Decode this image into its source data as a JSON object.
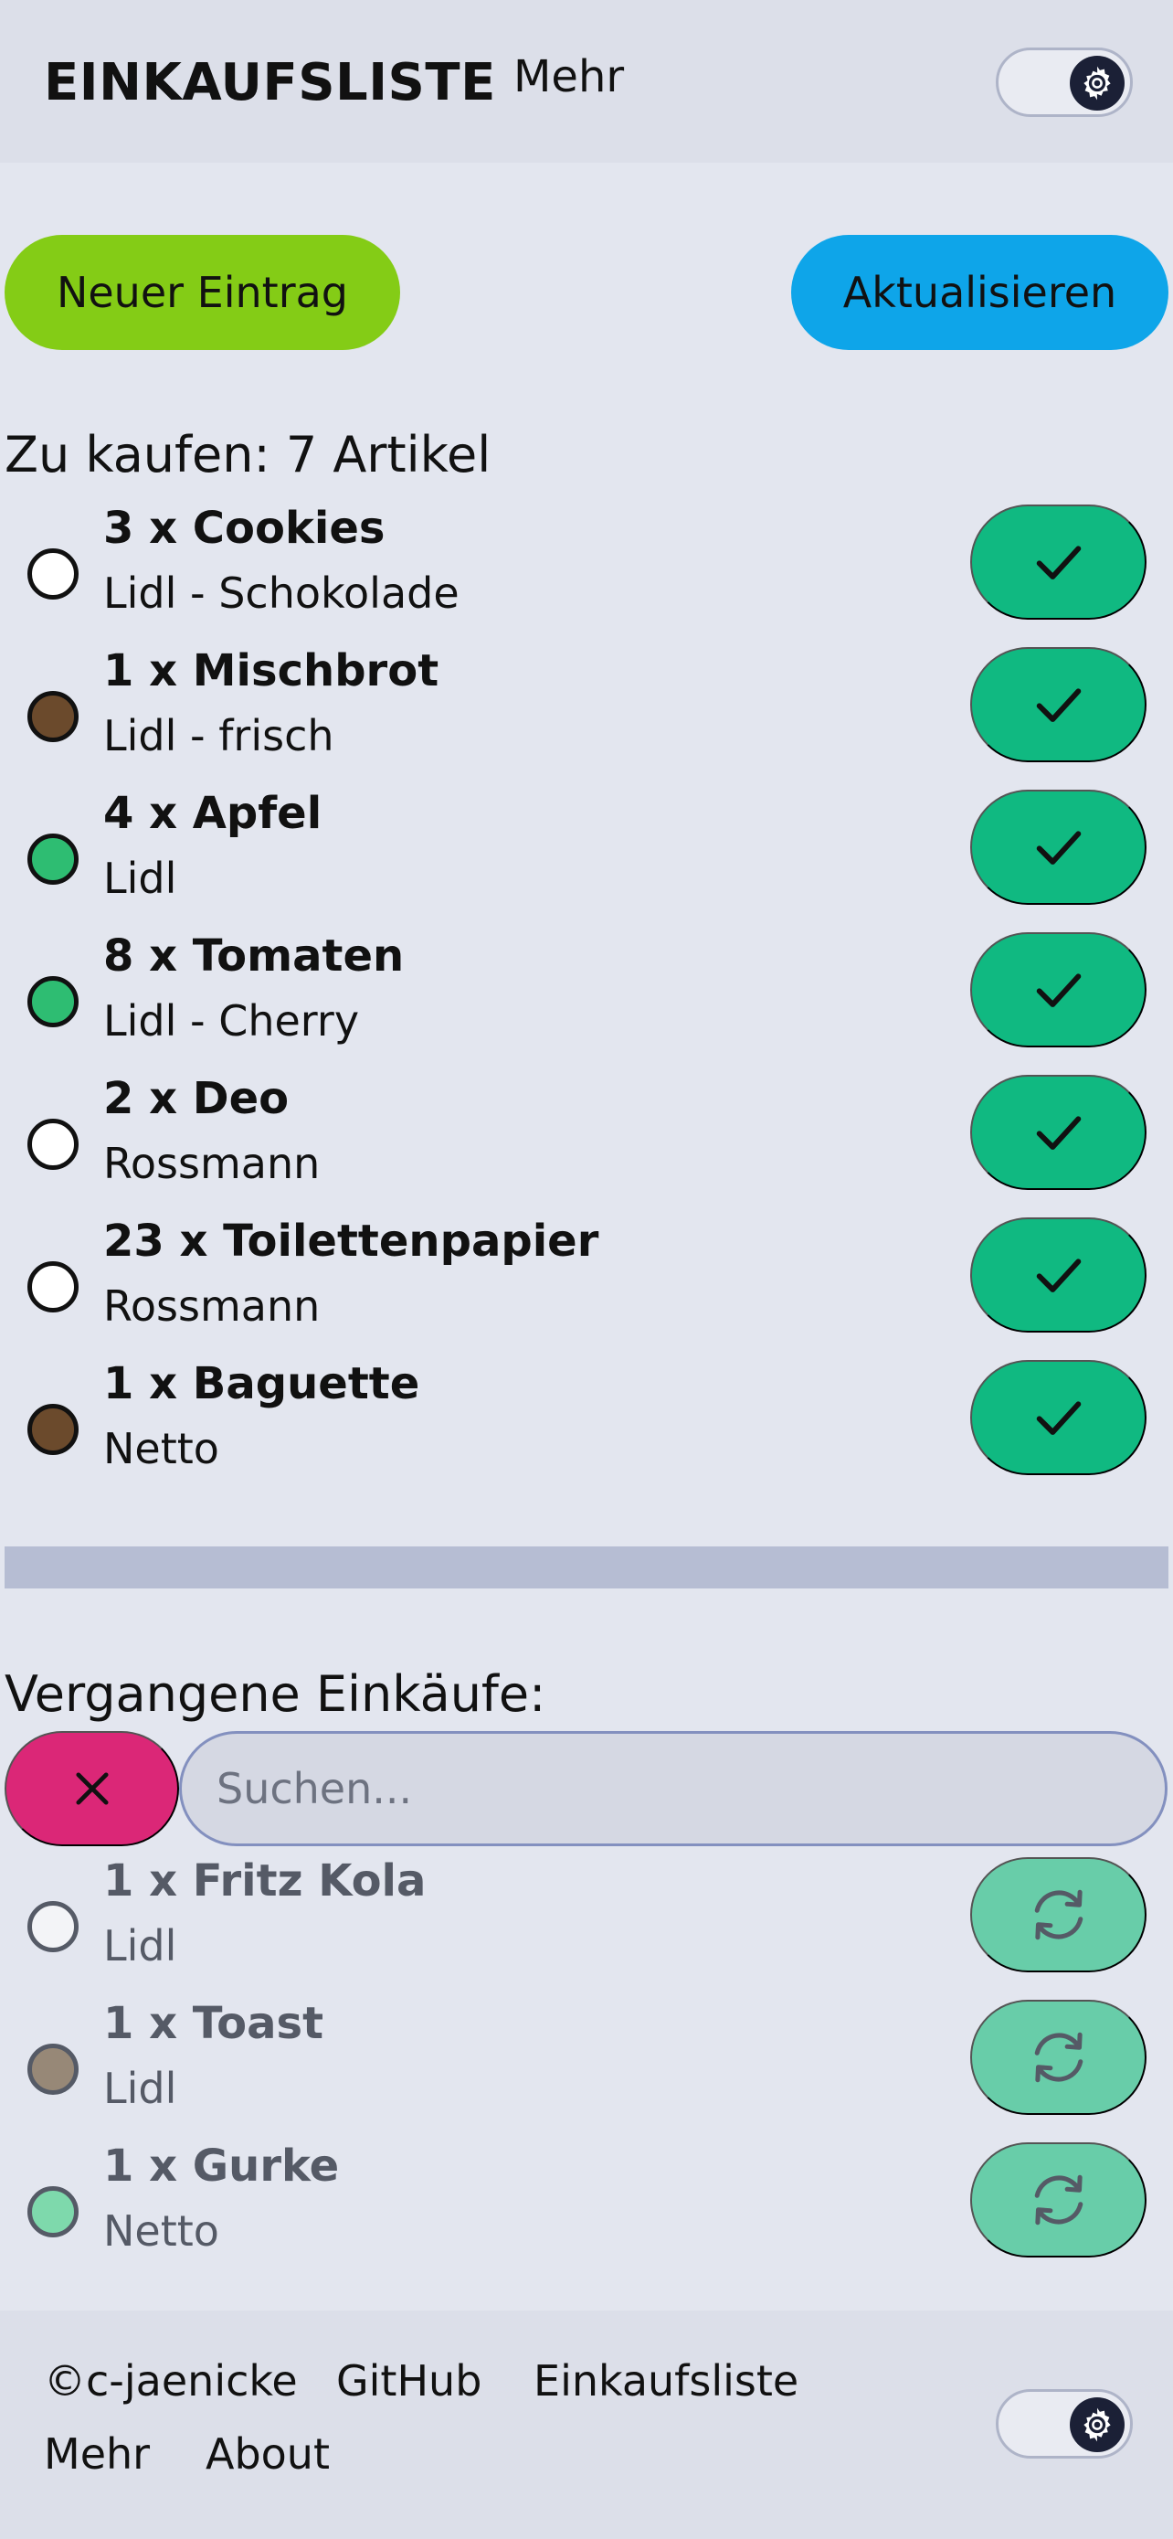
{
  "header": {
    "title": "EINKAUFSLISTE",
    "more_link": "Mehr",
    "settings_icon": "gear-icon"
  },
  "actions": {
    "new_entry": "Neuer Eintrag",
    "refresh": "Aktualisieren"
  },
  "to_buy": {
    "title": "Zu kaufen: 7 Artikel",
    "action_icon": "check-icon",
    "items": [
      {
        "name": "3 x Cookies",
        "sub": "Lidl - Schokolade",
        "color": "#ffffff"
      },
      {
        "name": "1 x Mischbrot",
        "sub": "Lidl - frisch",
        "color": "#6b4a2c"
      },
      {
        "name": "4 x Apfel",
        "sub": "Lidl",
        "color": "#2ebd72"
      },
      {
        "name": "8 x Tomaten",
        "sub": "Lidl - Cherry",
        "color": "#2ebd72"
      },
      {
        "name": "2 x Deo",
        "sub": "Rossmann",
        "color": "#ffffff"
      },
      {
        "name": "23 x Toilettenpapier",
        "sub": "Rossmann",
        "color": "#ffffff"
      },
      {
        "name": "1 x Baguette",
        "sub": "Netto",
        "color": "#6b4a2c"
      }
    ]
  },
  "past": {
    "title": "Vergangene Einkäufe:",
    "clear_icon": "close-icon",
    "search_placeholder": "Suchen...",
    "action_icon": "refresh-icon",
    "items": [
      {
        "name": "1 x Fritz Kola",
        "sub": "Lidl",
        "color": "#f3f4f7"
      },
      {
        "name": "1 x Toast",
        "sub": "Lidl",
        "color": "#978877"
      },
      {
        "name": "1 x Gurke",
        "sub": "Netto",
        "color": "#7ed9ac"
      }
    ]
  },
  "footer": {
    "copyright": "©c-jaenicke",
    "github": "GitHub",
    "list": "Einkaufsliste",
    "more": "Mehr",
    "about": "About"
  },
  "colors": {
    "new_button": "#84cc16",
    "refresh_button": "#0ea5e9",
    "check_button": "#10b981",
    "clear_button": "#db2777"
  }
}
